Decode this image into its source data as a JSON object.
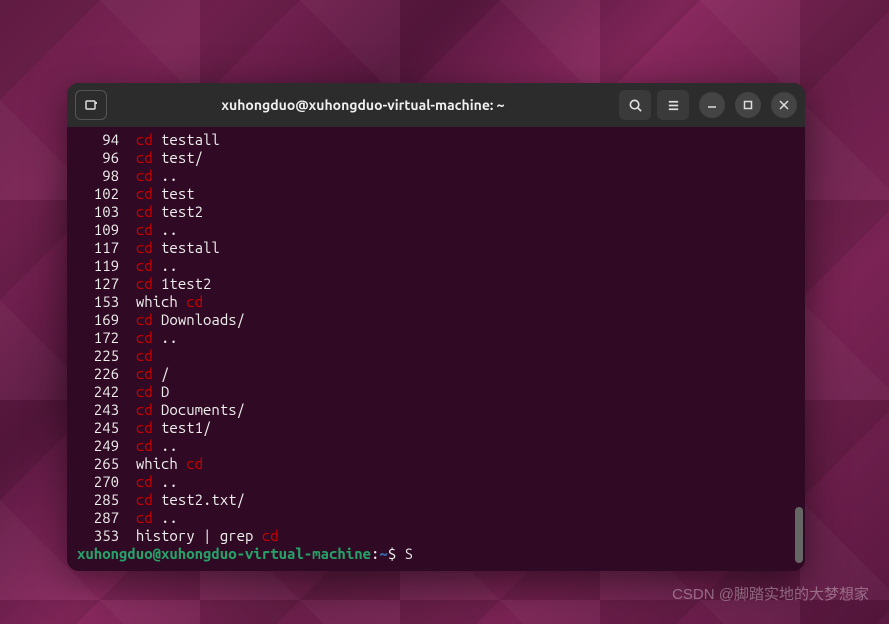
{
  "window": {
    "title": "xuhongduo@xuhongduo-virtual-machine: ~"
  },
  "history": [
    {
      "num": "   94",
      "cmd": "cd",
      "arg": " testall"
    },
    {
      "num": "   96",
      "cmd": "cd",
      "arg": " test/"
    },
    {
      "num": "   98",
      "cmd": "cd",
      "arg": " .."
    },
    {
      "num": "  102",
      "cmd": "cd",
      "arg": " test"
    },
    {
      "num": "  103",
      "cmd": "cd",
      "arg": " test2"
    },
    {
      "num": "  109",
      "cmd": "cd",
      "arg": " .."
    },
    {
      "num": "  117",
      "cmd": "cd",
      "arg": " testall"
    },
    {
      "num": "  119",
      "cmd": "cd",
      "arg": " .."
    },
    {
      "num": "  127",
      "cmd": "cd",
      "arg": " 1test2"
    },
    {
      "num": "  153",
      "pre": "which ",
      "cmd": "cd",
      "arg": ""
    },
    {
      "num": "  169",
      "cmd": "cd",
      "arg": " Downloads/"
    },
    {
      "num": "  172",
      "cmd": "cd",
      "arg": " .."
    },
    {
      "num": "  225",
      "cmd": "cd",
      "arg": ""
    },
    {
      "num": "  226",
      "cmd": "cd",
      "arg": " /"
    },
    {
      "num": "  242",
      "cmd": "cd",
      "arg": " D"
    },
    {
      "num": "  243",
      "cmd": "cd",
      "arg": " Documents/"
    },
    {
      "num": "  245",
      "cmd": "cd",
      "arg": " test1/"
    },
    {
      "num": "  249",
      "cmd": "cd",
      "arg": " .."
    },
    {
      "num": "  265",
      "pre": "which ",
      "cmd": "cd",
      "arg": ""
    },
    {
      "num": "  270",
      "cmd": "cd",
      "arg": " .."
    },
    {
      "num": "  285",
      "cmd": "cd",
      "arg": " test2.txt/"
    },
    {
      "num": "  287",
      "cmd": "cd",
      "arg": " .."
    },
    {
      "num": "  353",
      "pre": "history | grep ",
      "cmd": "cd",
      "arg": ""
    }
  ],
  "prompt": {
    "user_host": "xuhongduo@xuhongduo-virtual-machine",
    "sep1": ":",
    "path": "~",
    "sep2": "$ ",
    "input": "S"
  },
  "watermark": "CSDN @脚踏实地的大梦想家"
}
